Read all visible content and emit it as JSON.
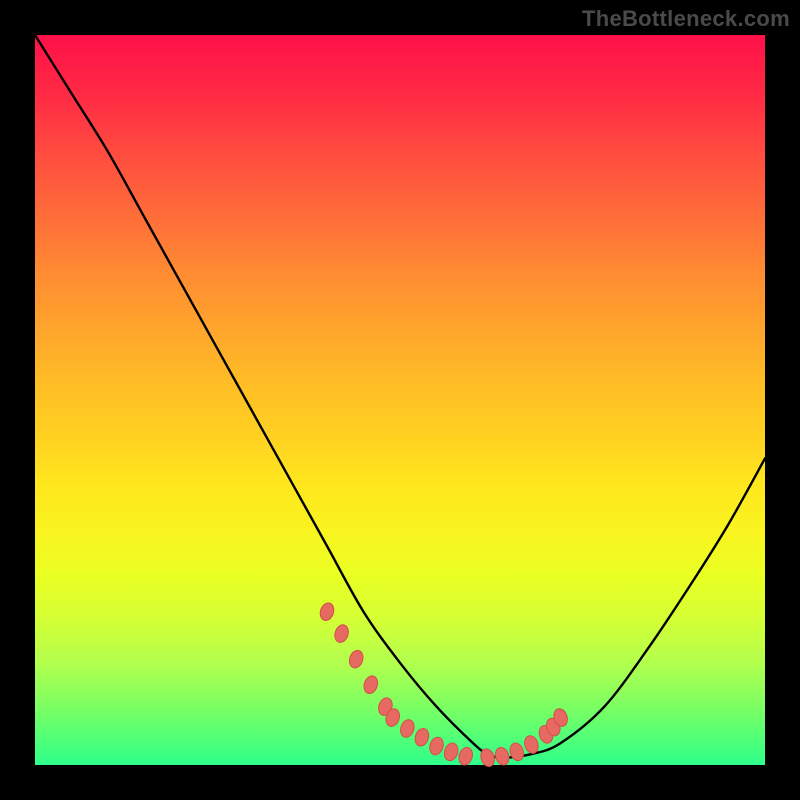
{
  "watermark": "TheBottleneck.com",
  "colors": {
    "page_bg": "#000000",
    "line": "#000000",
    "marker_fill": "#e66a62",
    "marker_stroke": "#d14f47"
  },
  "chart_data": {
    "type": "line",
    "title": "",
    "xlabel": "",
    "ylabel": "",
    "xlim": [
      0,
      100
    ],
    "ylim": [
      0,
      100
    ],
    "grid": false,
    "legend": null,
    "series": [
      {
        "name": "bottleneck-curve",
        "x": [
          0,
          5,
          10,
          15,
          20,
          25,
          30,
          35,
          40,
          45,
          50,
          55,
          60,
          62,
          64,
          68,
          72,
          78,
          84,
          90,
          95,
          100
        ],
        "y": [
          100,
          92,
          84,
          75,
          66,
          57,
          48,
          39,
          30,
          21,
          14,
          8,
          3,
          1.5,
          1,
          1.5,
          3,
          8,
          16,
          25,
          33,
          42
        ]
      }
    ],
    "markers": {
      "name": "highlight-cluster",
      "x": [
        40,
        42,
        44,
        46,
        48,
        49,
        51,
        53,
        55,
        57,
        59,
        62,
        64,
        66,
        68,
        70,
        71,
        72
      ],
      "y": [
        21,
        18,
        14.5,
        11,
        8,
        6.5,
        5,
        3.8,
        2.6,
        1.8,
        1.2,
        1,
        1.2,
        1.8,
        2.8,
        4.2,
        5.2,
        6.5
      ]
    }
  }
}
